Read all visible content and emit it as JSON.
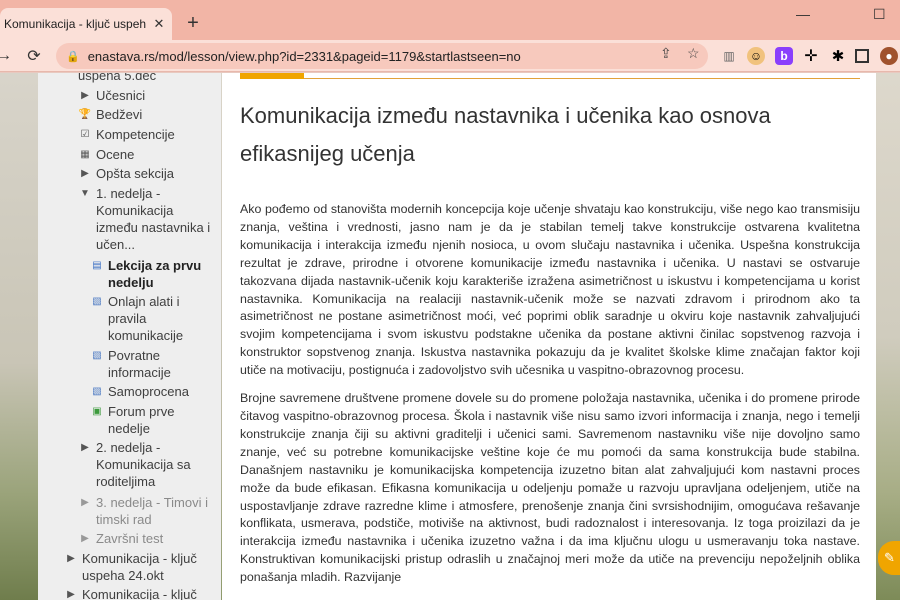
{
  "browser": {
    "tab_title": "Komunikacija - ključ uspeha 5.dec",
    "tab_close": "✕",
    "new_tab": "+",
    "url": "enastava.rs/mod/lesson/view.php?id=2331&pageid=1179&startlastseen=no",
    "minimize": "—",
    "maximize": "☐"
  },
  "sidebar": {
    "items": [
      {
        "icon": "none",
        "label": "uspeha 5.dec"
      },
      {
        "icon": "triangle-right",
        "label": "Učesnici"
      },
      {
        "icon": "trophy",
        "label": "Bedževi"
      },
      {
        "icon": "checkbox",
        "label": "Kompetencije"
      },
      {
        "icon": "grid",
        "label": "Ocene"
      },
      {
        "icon": "triangle-right",
        "label": "Opšta sekcija"
      },
      {
        "icon": "triangle-down",
        "label": "1. nedelja - Komunikacija između nastavnika i učen..."
      },
      {
        "icon": "lesson",
        "label": "Lekcija za prvu nedelju"
      },
      {
        "icon": "page",
        "label": "Onlajn alati i pravila komunikacije"
      },
      {
        "icon": "page",
        "label": "Povratne informacije"
      },
      {
        "icon": "page",
        "label": "Samoprocena"
      },
      {
        "icon": "forum",
        "label": "Forum prve nedelje"
      },
      {
        "icon": "triangle-right",
        "label": "2. nedelja - Komunikacija sa roditeljima"
      },
      {
        "icon": "triangle-right",
        "label": "3. nedelja - Timovi i timski rad"
      },
      {
        "icon": "triangle-right",
        "label": "Završni test"
      },
      {
        "icon": "triangle-right",
        "label": "Komunikacija - ključ uspeha 24.okt"
      },
      {
        "icon": "triangle-right",
        "label": "Komunikacija - ključ"
      }
    ]
  },
  "main": {
    "title": "Komunikacija između nastavnika i učenika kao osnova efikasnijeg učenja",
    "paragraphs": [
      "Ako pođemo od stanovišta modernih koncepcija koje učenje shvataju kao konstrukciju, više nego kao transmisiju znanja, veština i vrednosti, jasno nam  je da je stabilan temelj takve konstrukcije ostvarena kvalitetna komunikacija i interakcija između njenih nosioca, u ovom slučaju nastavnika i učenika. Uspešna konstrukcija rezultat je zdrave, prirodne i otvorene komunikacije između nastavnika i učenika. U nastavi se ostvaruje takozvana dijada nastavnik-učenik koju karakteriše izražena asimetričnost u iskustvu i kompetencijama u korist nastavnika. Komunikacija na realaciji nastavnik-učenik može se nazvati zdravom i prirodnom ako ta asimetričnost ne postane asimetričnost moći, već poprimi oblik saradnje u okviru koje nastavnik zahvaljujući svojim kompetencijama i svom iskustvu podstakne  učenika da postane aktivni činilac sopstvenog razvoja i konstruktor sopstvenog znanja. Iskustva nastavnika pokazuju da je kvalitet školske klime značajan faktor koji utiče na motivaciju, postignuća i zadovoljstvo svih učesnika u vaspitno-obrazovnog procesu.",
      "Brojne savremene društvene promene dovele su do promene položaja nastavnika, učenika  i do promene prirode čitavog vaspitno-obrazovnog procesa. Škola i nastavnik više nisu samo izvori informacija i znanja, nego i temelji konstrukcije znanja čiji su aktivni graditelji i učenici sami. Savremenom nastavniku više nije dovoljno samo znanje, već su potrebne komunikacijske veštine koje će mu pomoći da sama konstrukcija bude stabilna. Današnjem nastavniku je komunikacijska kompetencija izuzetno bitan alat zahvaljujući kom nastavni proces može da bude efikasan. Efikasna komunikacija u odeljenju pomaže u razvoju upravljana odeljenjem, utiče na uspostavljanje zdrave razredne klime i atmosfere, prenošenje znanja čini svrsishodnijim, omogućava rešavanje konflikata, usmerava, podstiče, motiviše na aktivnost, budi radoznalost i interesovanja. Iz toga proizilazi da je interakcija između nastavnika i učenika izuzetno važna i   da ima ključnu ulogu u usmeravanju toka nastave. Konstruktivan komunikacijski pristup odraslih u značajnoj meri može da utiče na prevenciju nepoželjnih oblika ponašanja mladih. Razvijanje"
    ]
  },
  "colors": {
    "accent": "#f0a500",
    "tabbar": "#f2b5a6",
    "toolbar": "#fbe0d8"
  }
}
